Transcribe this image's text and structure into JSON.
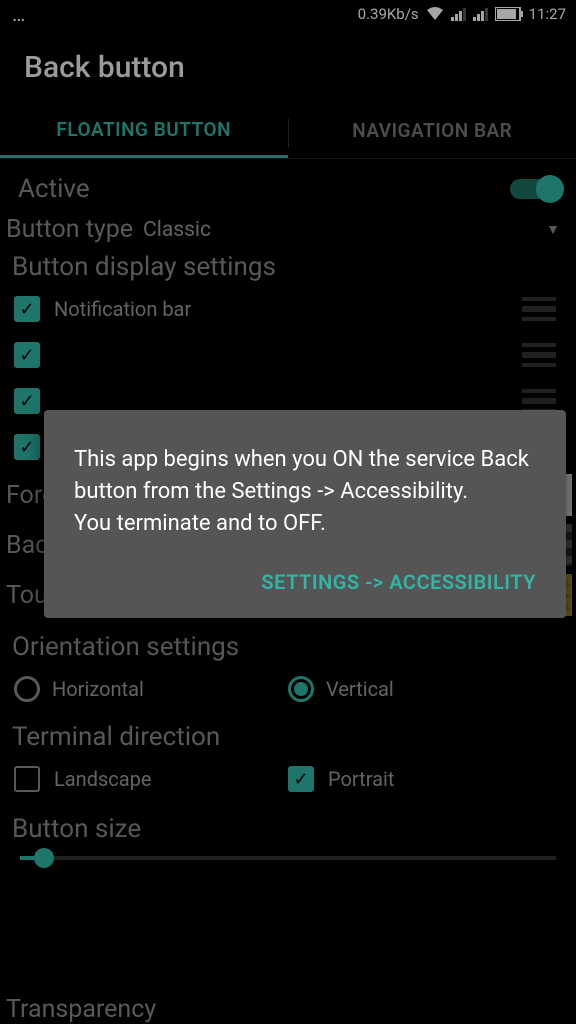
{
  "statusbar": {
    "speed": "0.39Kb/s",
    "time": "11:27"
  },
  "title": "Back button",
  "tabs": {
    "floating": "FLOATING BUTTON",
    "nav": "NAVIGATION BAR"
  },
  "settings": {
    "active_label": "Active",
    "button_type_label": "Button type",
    "button_type_value": "Classic",
    "display_settings_label": "Button display settings",
    "notification_bar": "Notification bar",
    "foreground_color": "Foreground Color",
    "background_color": "Background Color",
    "touch_color": "Touch Color",
    "orientation_label": "Orientation settings",
    "orientation_h": "Horizontal",
    "orientation_v": "Vertical",
    "terminal_label": "Terminal direction",
    "terminal_landscape": "Landscape",
    "terminal_portrait": "Portrait",
    "button_size_label": "Button size",
    "transparency_label": "Transparency"
  },
  "dialog": {
    "body": "This app begins when you ON the service Back button from the Settings -> Accessibility.\nYou terminate and to OFF.",
    "action": "SETTINGS -> ACCESSIBILITY"
  }
}
